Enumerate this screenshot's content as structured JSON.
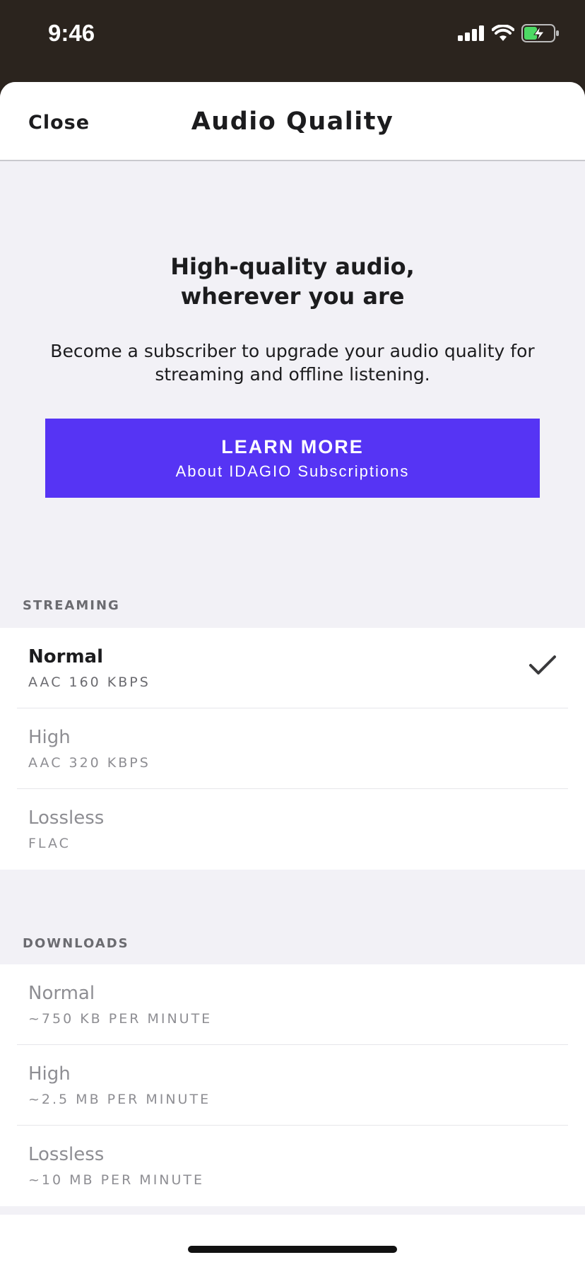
{
  "status_bar": {
    "time": "9:46"
  },
  "nav": {
    "close_label": "Close",
    "title": "Audio Quality"
  },
  "promo": {
    "title_line1": "High-quality audio,",
    "title_line2": "wherever you are",
    "description": "Become a subscriber to upgrade your audio quality for streaming and offline listening.",
    "button_main": "LEARN MORE",
    "button_sub": "About IDAGIO Subscriptions",
    "accent_color": "#5634f4"
  },
  "streaming": {
    "header": "STREAMING",
    "items": [
      {
        "title": "Normal",
        "subtitle": "AAC 160 KBPS",
        "selected": true
      },
      {
        "title": "High",
        "subtitle": "AAC 320 KBPS",
        "selected": false
      },
      {
        "title": "Lossless",
        "subtitle": "FLAC",
        "selected": false
      }
    ]
  },
  "downloads": {
    "header": "DOWNLOADS",
    "items": [
      {
        "title": "Normal",
        "subtitle": "~750 KB PER MINUTE"
      },
      {
        "title": "High",
        "subtitle": "~2.5 MB PER MINUTE"
      },
      {
        "title": "Lossless",
        "subtitle": "~10 MB PER MINUTE"
      }
    ]
  },
  "icons": [
    "cellular-signal-icon",
    "wifi-icon",
    "battery-charging-icon",
    "checkmark-icon"
  ]
}
